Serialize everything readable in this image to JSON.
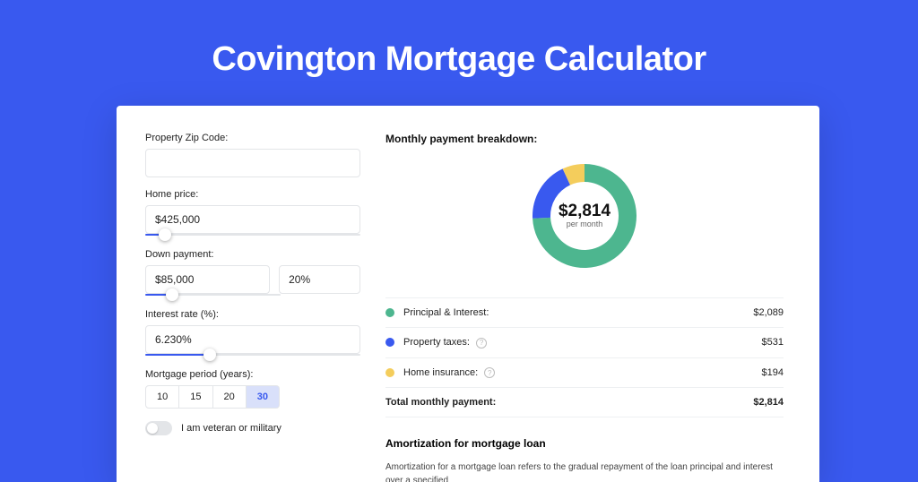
{
  "page_title": "Covington Mortgage Calculator",
  "form": {
    "zip_label": "Property Zip Code:",
    "zip_value": "",
    "home_price_label": "Home price:",
    "home_price_value": "$425,000",
    "home_price_slider_pct": 9,
    "down_label": "Down payment:",
    "down_value": "$85,000",
    "down_pct_value": "20%",
    "down_slider_pct": 20,
    "rate_label": "Interest rate (%):",
    "rate_value": "6.230%",
    "rate_slider_pct": 30,
    "period_label": "Mortgage period (years):",
    "period_options": [
      "10",
      "15",
      "20",
      "30"
    ],
    "period_selected_index": 3,
    "veteran_label": "I am veteran or military",
    "veteran_on": false
  },
  "breakdown": {
    "heading": "Monthly payment breakdown:",
    "center_value": "$2,814",
    "center_sub": "per month",
    "items": [
      {
        "label": "Principal & Interest:",
        "value": "$2,089",
        "color": "#4db68f",
        "has_info": false
      },
      {
        "label": "Property taxes:",
        "value": "$531",
        "color": "#3959ef",
        "has_info": true
      },
      {
        "label": "Home insurance:",
        "value": "$194",
        "color": "#f4cd5c",
        "has_info": true
      }
    ],
    "total_label": "Total monthly payment:",
    "total_value": "$2,814"
  },
  "chart_data": {
    "type": "pie",
    "title": "Monthly payment breakdown",
    "series": [
      {
        "name": "Principal & Interest",
        "value": 2089,
        "color": "#4db68f"
      },
      {
        "name": "Property taxes",
        "value": 531,
        "color": "#3959ef"
      },
      {
        "name": "Home insurance",
        "value": 194,
        "color": "#f4cd5c"
      }
    ],
    "total": 2814,
    "center_label": "$2,814 per month"
  },
  "amort": {
    "heading": "Amortization for mortgage loan",
    "body": "Amortization for a mortgage loan refers to the gradual repayment of the loan principal and interest over a specified"
  }
}
